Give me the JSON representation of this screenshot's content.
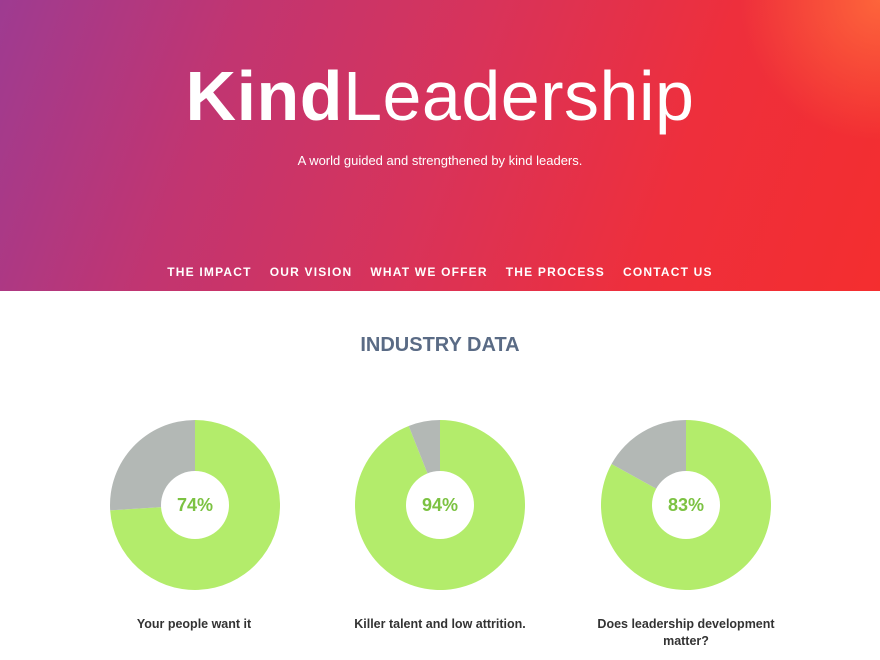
{
  "hero": {
    "brand_bold": "Kind",
    "brand_light": "Leadership",
    "tagline": "A world guided and strengthened by kind leaders."
  },
  "nav": {
    "items": [
      {
        "label": "THE IMPACT"
      },
      {
        "label": "OUR VISION"
      },
      {
        "label": "WHAT WE OFFER"
      },
      {
        "label": "THE PROCESS"
      },
      {
        "label": "CONTACT US"
      }
    ]
  },
  "section": {
    "title": "INDUSTRY DATA"
  },
  "colors": {
    "filled": "#b3ec6b",
    "remaining": "#b3b8b5",
    "percent_text": "#7cc242",
    "title": "#5a6b85"
  },
  "chart_data": [
    {
      "type": "pie",
      "value": 74,
      "label": "74%",
      "caption": "Your people want it"
    },
    {
      "type": "pie",
      "value": 94,
      "label": "94%",
      "caption": "Killer talent and low attrition."
    },
    {
      "type": "pie",
      "value": 83,
      "label": "83%",
      "caption": "Does leadership development matter?"
    }
  ]
}
